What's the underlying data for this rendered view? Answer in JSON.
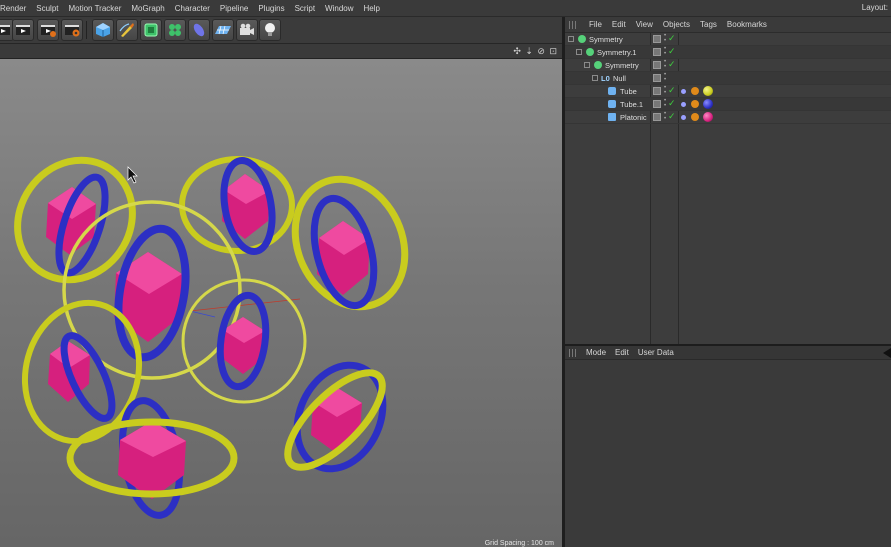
{
  "menubar": {
    "items": [
      "Render",
      "Sculpt",
      "Motion Tracker",
      "MoGraph",
      "Character",
      "Pipeline",
      "Plugins",
      "Script",
      "Window",
      "Help"
    ],
    "layout_label": "Layout:"
  },
  "toolbar": {
    "icons": [
      "render-region-icon",
      "render-view-icon",
      "render-picture-viewer-icon",
      "render-settings-icon",
      "cube-icon",
      "pen-spline-icon",
      "subdivision-surface-icon",
      "cloner-icon",
      "deformer-icon",
      "floor-grid-icon",
      "camera-icon",
      "light-bulb-icon"
    ]
  },
  "viewport": {
    "grid_spacing": "Grid Spacing : 100 cm",
    "nav_icons": "✣ ⇣ ⊘ ⊡"
  },
  "object_manager": {
    "menu": [
      "File",
      "Edit",
      "View",
      "Objects",
      "Tags",
      "Bookmarks"
    ],
    "objects": [
      {
        "name": "Symmetry",
        "icon_color": "#56d17a",
        "depth": 0
      },
      {
        "name": "Symmetry.1",
        "icon_color": "#56d17a",
        "depth": 1
      },
      {
        "name": "Symmetry",
        "icon_color": "#56d17a",
        "depth": 2
      },
      {
        "name": "Null",
        "icon_color": "#cfcfcf",
        "depth": 3
      },
      {
        "name": "Tube",
        "icon_color": "#6fb2f0",
        "depth": 4
      },
      {
        "name": "Tube.1",
        "icon_color": "#6fb2f0",
        "depth": 4
      },
      {
        "name": "Platonic",
        "icon_color": "#6fb2f0",
        "depth": 4
      }
    ]
  },
  "attribute_manager": {
    "menu": [
      "Mode",
      "Edit",
      "User Data"
    ]
  },
  "colors": {
    "ring_yellow": "#c9cc1e",
    "ring_blue": "#2c2fc4",
    "platonic_magenta": "#d6207e",
    "check_green": "#3fcf3f"
  }
}
